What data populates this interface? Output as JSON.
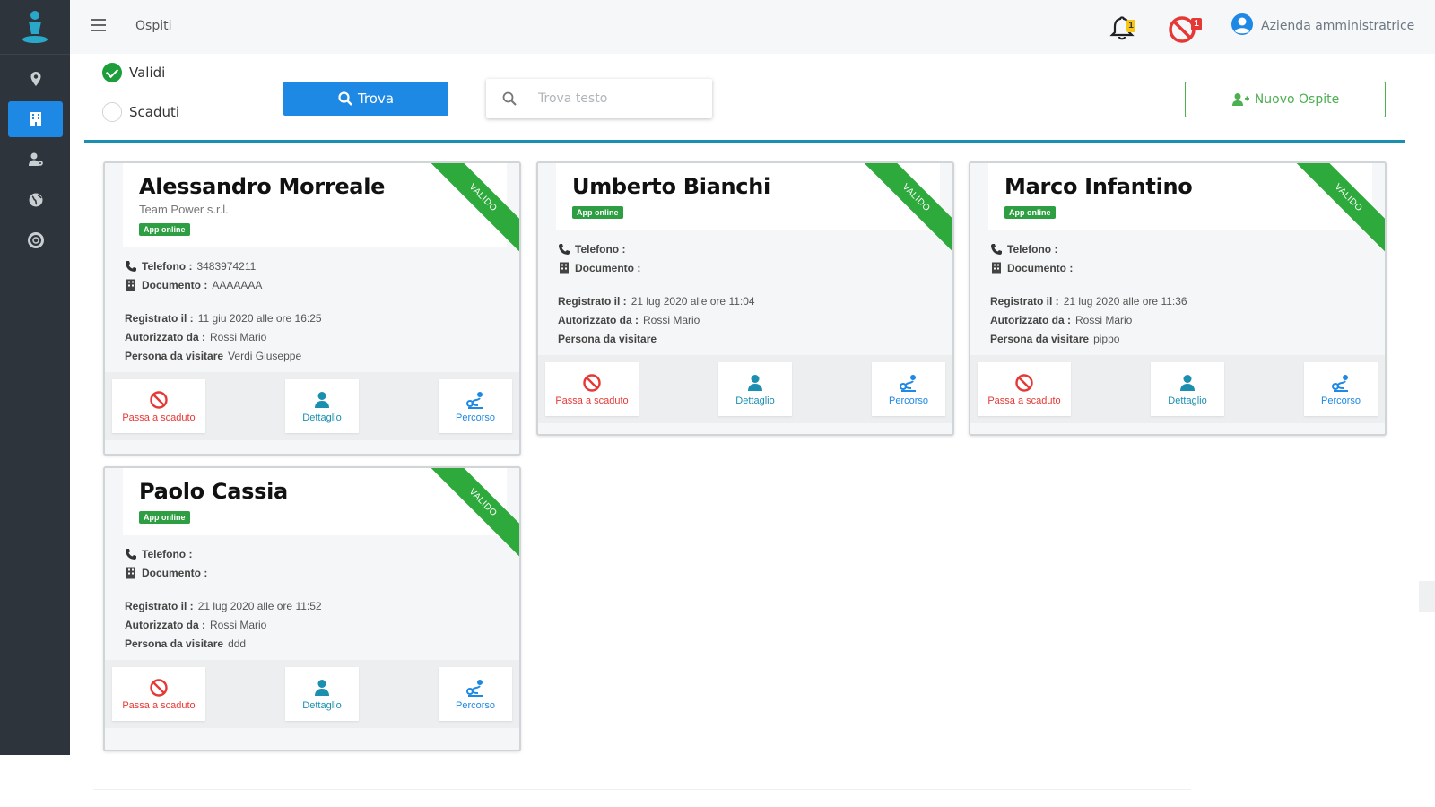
{
  "topbar": {
    "title": "Ospiti",
    "notifications_count": "1",
    "blocked_count": "1",
    "user_name": "Azienda amministratrice"
  },
  "filters": {
    "valid_label": "Validi",
    "expired_label": "Scaduti",
    "selected": "Validi",
    "find_button": "Trova",
    "search_placeholder": "Trova testo",
    "search_value": "",
    "new_guest_button": "Nuovo Ospite"
  },
  "colors": {
    "sidebar": "#2e343b",
    "primary": "#1e88e5",
    "valid_green": "#2eaa3d",
    "danger": "#e53935",
    "teal": "#1a8fb0"
  },
  "labels": {
    "phone": "Telefono :",
    "document": "Documento :",
    "registered": "Registrato il :",
    "authorized": "Autorizzato da :",
    "visiting": "Persona da visitare",
    "app_badge": "App online",
    "ribbon": "VALIDO",
    "action_expire": "Passa a scaduto",
    "action_detail": "Dettaglio",
    "action_route": "Percorso"
  },
  "guests": [
    {
      "name": "Alessandro Morreale",
      "company": "Team Power s.r.l.",
      "phone": "3483974211",
      "document": "AAAAAAA",
      "registered": "11 giu 2020 alle ore 16:25",
      "authorized_by": "Rossi Mario",
      "visiting": "Verdi Giuseppe"
    },
    {
      "name": "Umberto Bianchi",
      "company": "",
      "phone": "",
      "document": "",
      "registered": "21 lug 2020 alle ore 11:04",
      "authorized_by": "Rossi Mario",
      "visiting": ""
    },
    {
      "name": "Marco Infantino",
      "company": "",
      "phone": "",
      "document": "",
      "registered": "21 lug 2020 alle ore 11:36",
      "authorized_by": "Rossi Mario",
      "visiting": "pippo"
    },
    {
      "name": "Paolo Cassia",
      "company": "",
      "phone": "",
      "document": "",
      "registered": "21 lug 2020 alle ore 11:52",
      "authorized_by": "Rossi Mario",
      "visiting": "ddd"
    }
  ]
}
